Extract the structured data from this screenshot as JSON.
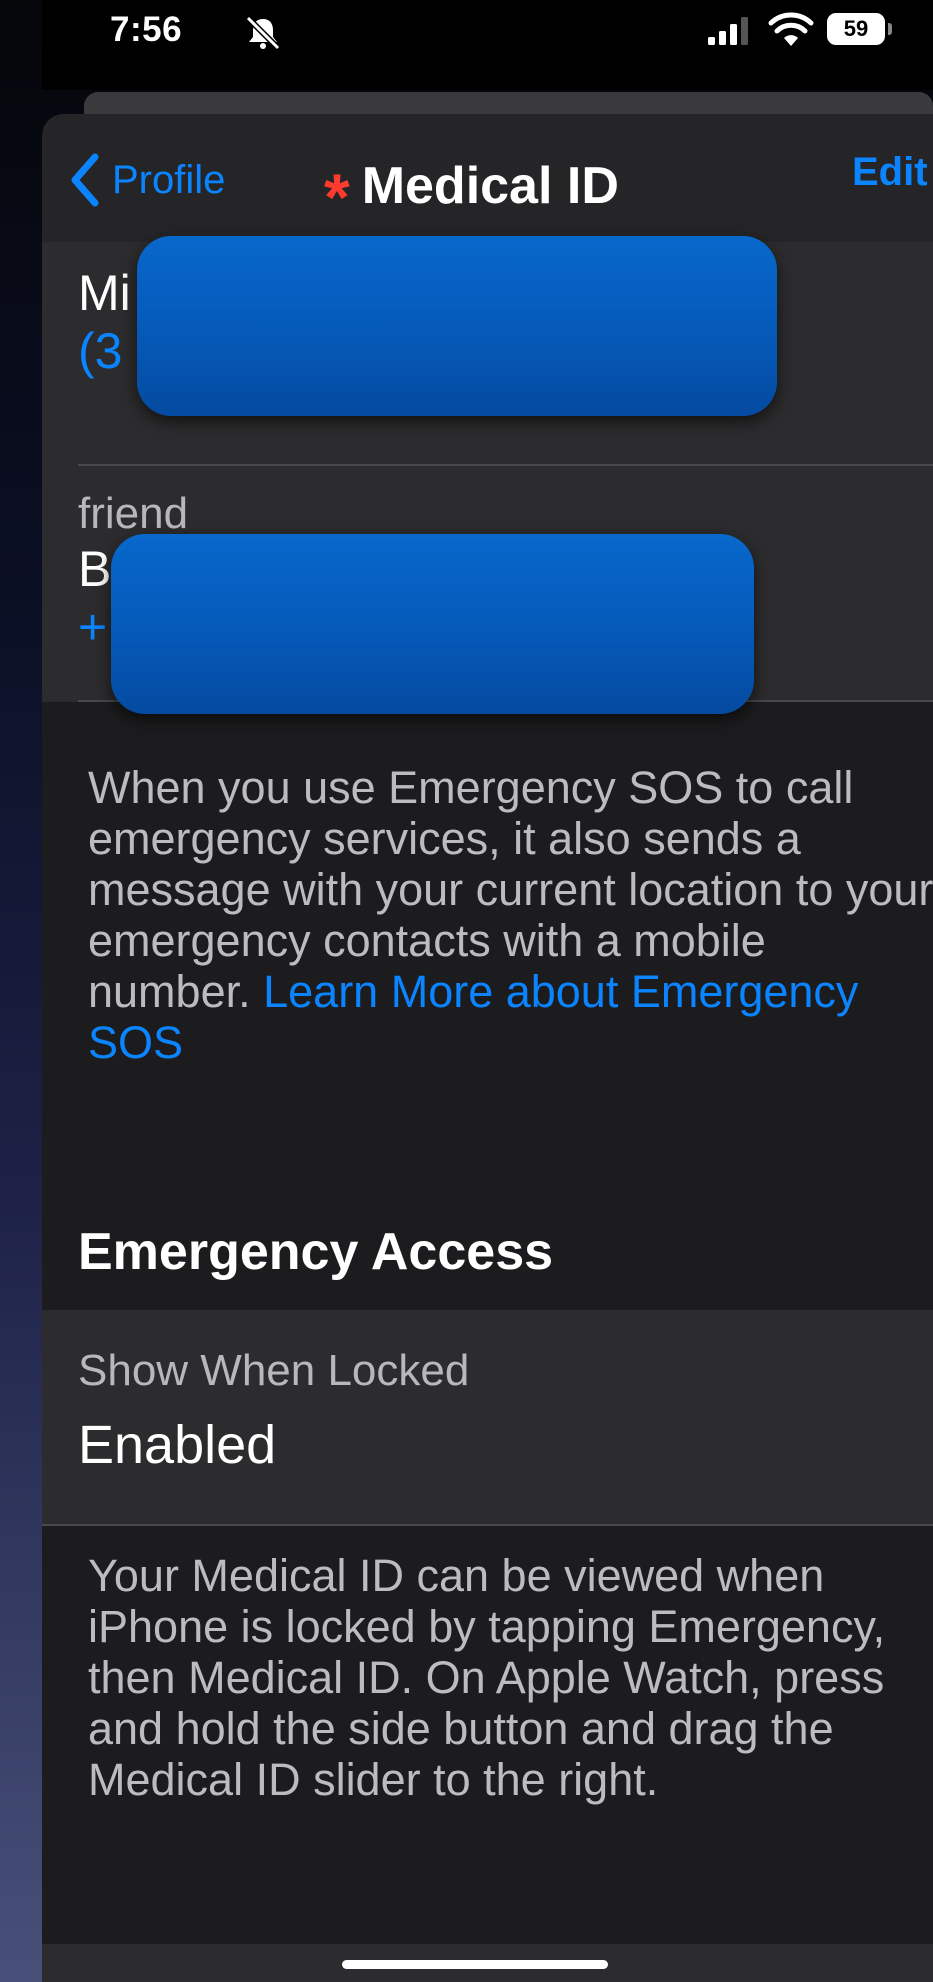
{
  "status_bar": {
    "time": "7:56",
    "battery": "59",
    "icons": [
      "bell-slash-icon",
      "signal-icon",
      "wifi-icon",
      "battery-icon"
    ]
  },
  "nav": {
    "back_label": "Profile",
    "title": "Medical ID",
    "edit_label": "Edit"
  },
  "contacts": [
    {
      "relation": "",
      "name": "Mi",
      "phone": "(3"
    },
    {
      "relation": "friend",
      "name": "B",
      "phone": "+"
    }
  ],
  "sos_note": {
    "text": "When you use Emergency SOS to call emergency services, it also sends a message with your current location to your emergency contacts with a mobile number. ",
    "link": "Learn More about Emergency SOS"
  },
  "emergency_access": {
    "header": "Emergency Access",
    "setting_label": "Show When Locked",
    "setting_value": "Enabled",
    "note": "Your Medical ID can be viewed when iPhone is locked by tapping Emergency, then Medical ID. On Apple Watch, press and hold the side button and drag the Medical ID slider to the right."
  },
  "colors": {
    "accent": "#0a84ff",
    "redaction": "#0559b8",
    "asterisk": "#ff3b30"
  }
}
